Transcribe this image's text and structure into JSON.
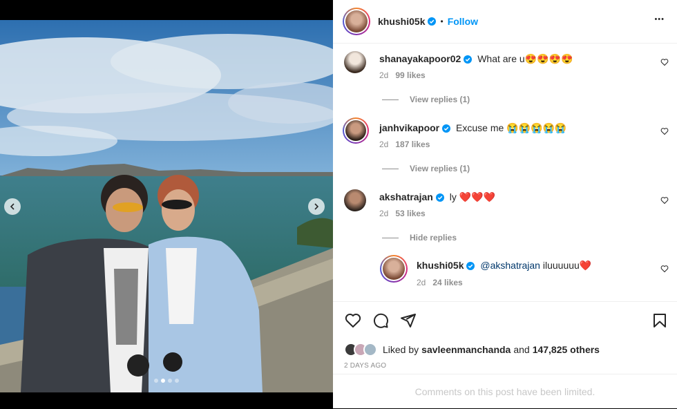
{
  "post": {
    "author": "khushi05k",
    "follow_label": "Follow",
    "separator": "•",
    "more_label": "•••"
  },
  "comments": [
    {
      "user": "shanayakapoor02",
      "text": "What are u",
      "emoji": "😍😍😍😍",
      "age": "2d",
      "likes": "99 likes",
      "replies": "View replies (1)"
    },
    {
      "user": "janhvikapoor",
      "text": "Excuse me",
      "emoji": "😭😭😭😭😭",
      "age": "2d",
      "likes": "187 likes",
      "replies": "View replies (1)"
    },
    {
      "user": "akshatrajan",
      "text": "ly",
      "emoji": "❤️❤️❤️",
      "age": "2d",
      "likes": "53 likes",
      "replies": "Hide replies"
    }
  ],
  "reply": {
    "user": "khushi05k",
    "mention": "@akshatrajan",
    "text": "iluuuuuu",
    "emoji": "❤️",
    "age": "2d",
    "likes": "24 likes"
  },
  "liked_by": {
    "prefix": "Liked by",
    "user": "savleenmanchanda",
    "middle": "and",
    "count": "147,825 others"
  },
  "date": "2 DAYS AGO",
  "limited_text": "Comments on this post have been limited.",
  "carousel": {
    "slides": 4,
    "active": 2
  }
}
